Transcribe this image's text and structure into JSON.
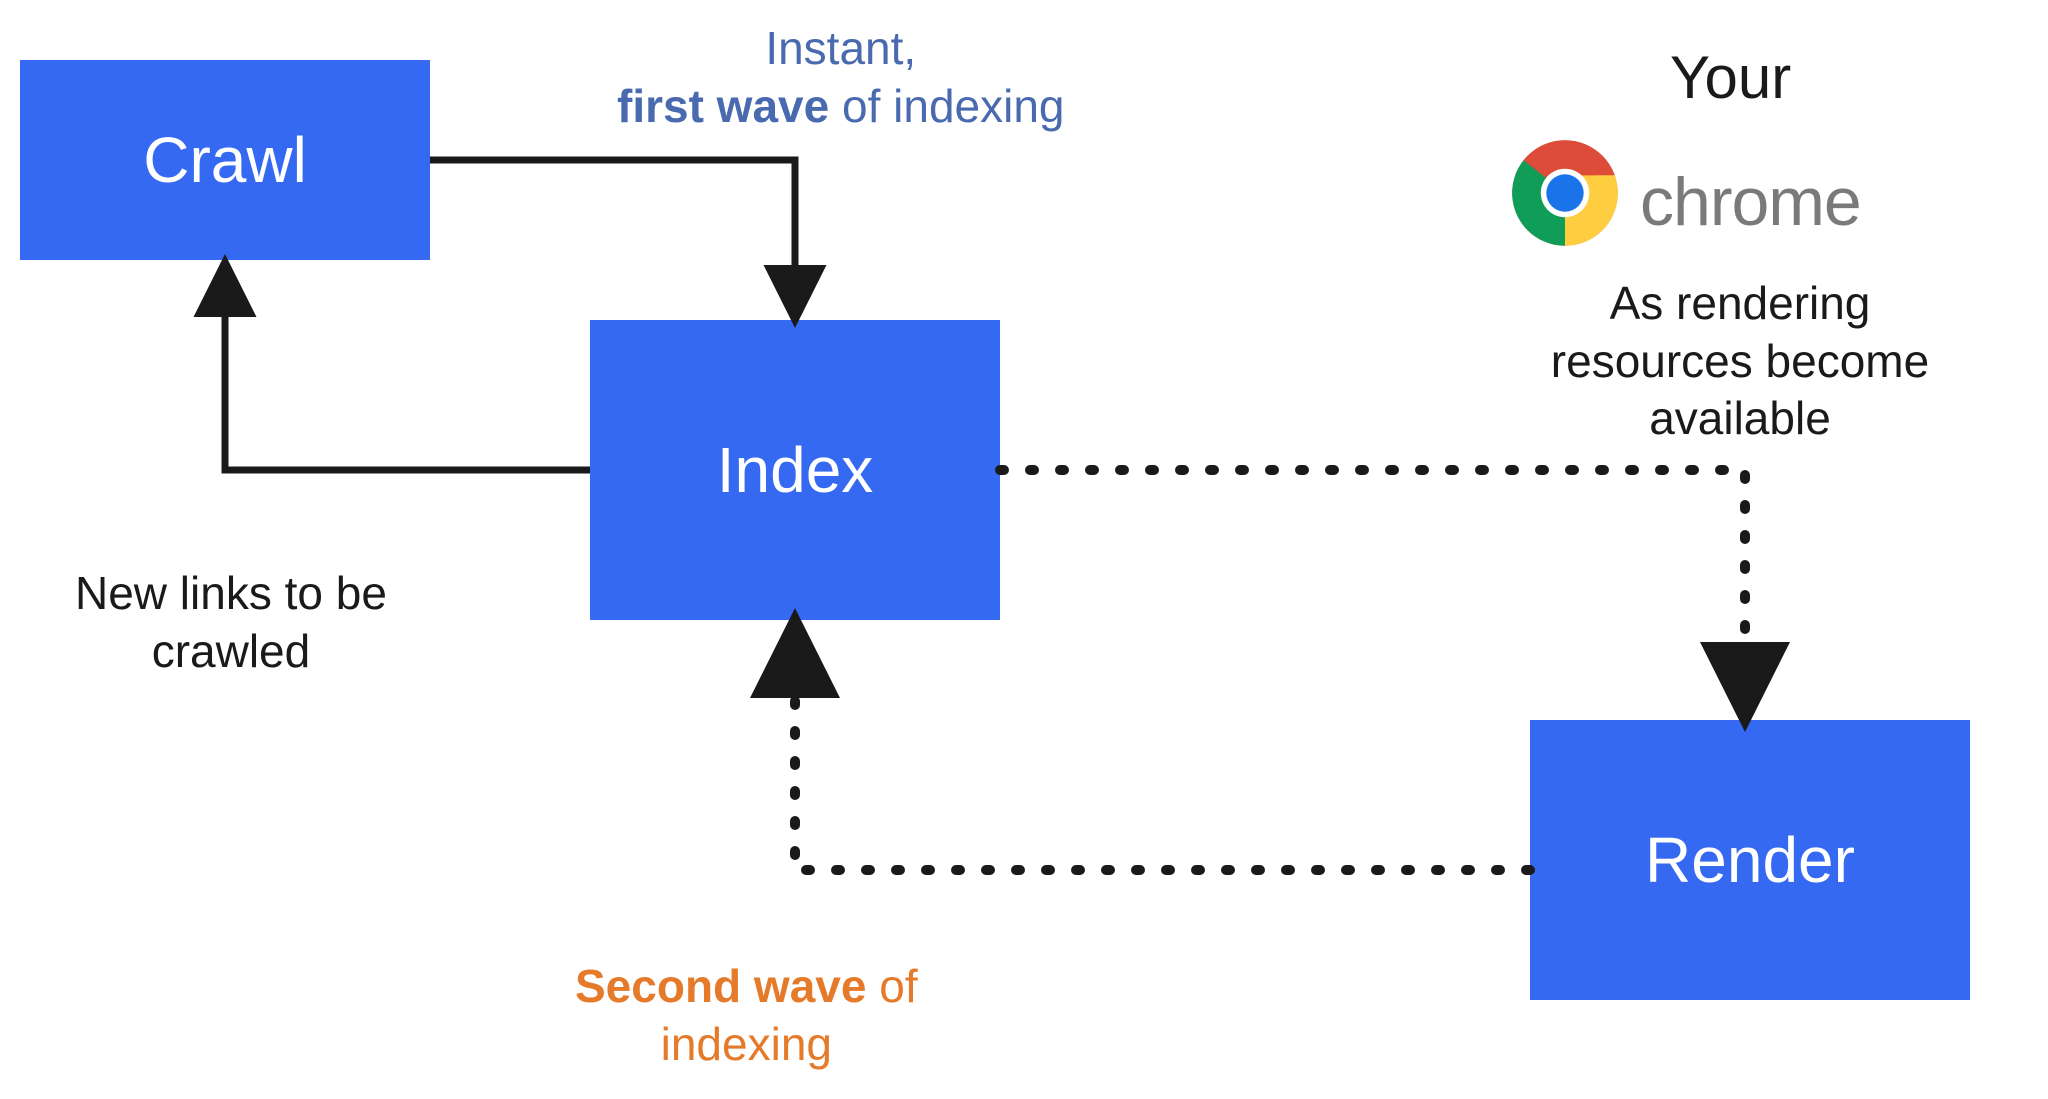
{
  "nodes": {
    "crawl": "Crawl",
    "index": "Index",
    "render": "Render"
  },
  "labels": {
    "first_wave_line1": "Instant,",
    "first_wave_bold": "first wave",
    "first_wave_after": " of indexing",
    "new_links_line1": "New links to be",
    "new_links_line2": "crawled",
    "second_wave_bold": "Second wave",
    "second_wave_after": " of",
    "second_wave_line2": "indexing",
    "rendering_line1": "As rendering",
    "rendering_line2": "resources become",
    "rendering_line3": "available",
    "your": "Your",
    "chrome": "chrome"
  },
  "edges": [
    {
      "from": "crawl",
      "to": "index",
      "style": "solid",
      "label_key": "first_wave"
    },
    {
      "from": "index",
      "to": "crawl",
      "style": "solid",
      "label_key": "new_links"
    },
    {
      "from": "index",
      "to": "render",
      "style": "dotted",
      "label_key": "rendering"
    },
    {
      "from": "render",
      "to": "index",
      "style": "dotted",
      "label_key": "second_wave"
    }
  ],
  "colors": {
    "node_fill": "#3569f1",
    "node_text": "#ffffff",
    "arrow": "#1a1a1a",
    "label_blue": "#4a6ab0",
    "label_orange": "#e57a2a",
    "label_gray": "#7a7a7a"
  }
}
